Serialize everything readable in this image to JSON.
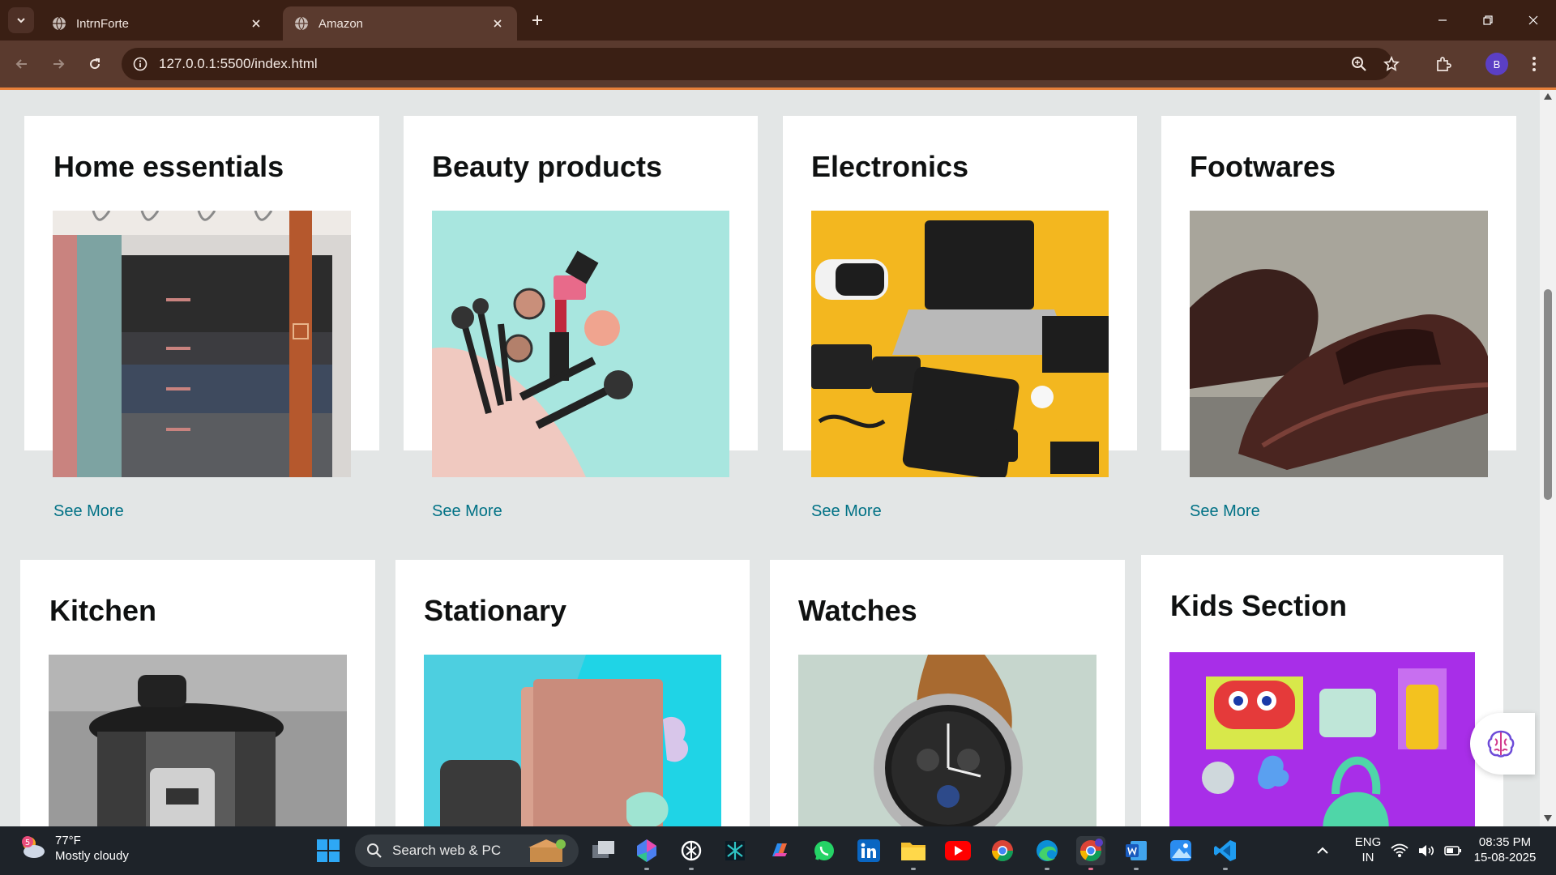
{
  "browser": {
    "tabs": [
      {
        "title": "IntrnForte",
        "active": false
      },
      {
        "title": "Amazon",
        "active": true
      }
    ],
    "url": "127.0.0.1:5500/index.html",
    "profile_initial": "B"
  },
  "cards": [
    {
      "title": "Home essentials",
      "link": "See More"
    },
    {
      "title": "Beauty products",
      "link": "See More"
    },
    {
      "title": "Electronics",
      "link": "See More"
    },
    {
      "title": "Footwares",
      "link": "See More"
    },
    {
      "title": "Kitchen"
    },
    {
      "title": "Stationary"
    },
    {
      "title": "Watches"
    },
    {
      "title": "Kids Section"
    }
  ],
  "taskbar": {
    "weather": {
      "temp": "77°F",
      "condition": "Mostly cloudy",
      "badge": "5"
    },
    "search_label": "Search web & PC",
    "lang": {
      "line1": "ENG",
      "line2": "IN"
    },
    "time": "08:35 PM",
    "date": "15-08-2025"
  },
  "colors": {
    "link": "#007185",
    "chrome_dark": "#3a1f14",
    "chrome_light": "#5a3a2e",
    "accent": "#e8803a",
    "page_bg": "#e3e6e6"
  }
}
